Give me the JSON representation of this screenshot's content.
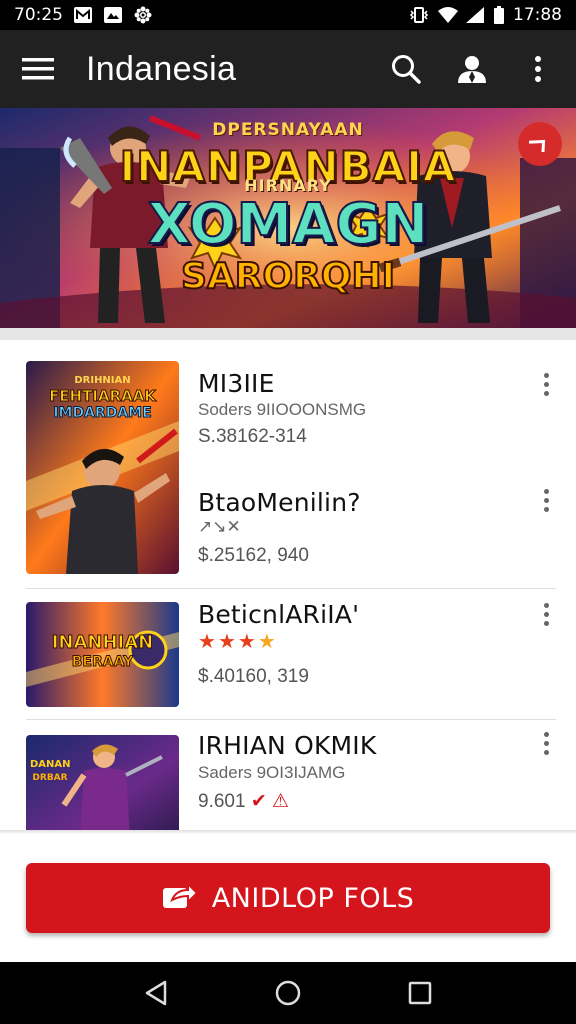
{
  "status_bar": {
    "time_left": "70:25",
    "time_right": "17:88",
    "icons_left": [
      "notification-icon",
      "photo-icon",
      "settings-flower-icon"
    ],
    "icons_right": [
      "vibrate-icon",
      "wifi-icon",
      "signal-icon",
      "battery-icon"
    ]
  },
  "app_bar": {
    "title": "Indanesia",
    "icons": [
      "menu-icon",
      "search-icon",
      "account-icon",
      "more-vert-icon"
    ]
  },
  "banner": {
    "line1": "DPERSNAYAAN",
    "line2": "INANPANBAIA",
    "line3": "HIRNARY",
    "line4": "XOMAGN",
    "line5": "SARORQHI",
    "close_icon": "chevron-close-icon"
  },
  "items": [
    {
      "thumb_text_1": "DRIHNIAN",
      "thumb_text_2": "FEHTIARAAK",
      "thumb_text_3": "IMDARDAME",
      "title": "MI3IIE",
      "subtitle": "Soders 9IIOOONSMG",
      "price": "S.38162-314"
    },
    {
      "title": "BtaoMenilin?",
      "subtitle": "↗↘✕",
      "price": "$.25162, 940"
    },
    {
      "thumb_text_1": "INANHIAN",
      "thumb_text_2": "BERAAY",
      "title": "BeticnlARiIA'",
      "rating": 4,
      "price": "$.40160, 319"
    },
    {
      "thumb_text_1": "DANAN",
      "thumb_text_2": "DRBAR",
      "title": "IRHIAN OKMIK",
      "subtitle": "Saders 9OI3IJAMG",
      "price": "9.601",
      "price_suffix": "✔ ⚠"
    }
  ],
  "cta": {
    "label": "ANIDLOP FOLS",
    "icon": "share-arrow-icon"
  },
  "nav_bar": {
    "icons": [
      "back-icon",
      "home-icon",
      "recents-icon"
    ]
  },
  "colors": {
    "accent": "#d4161c",
    "app_bar": "#212121",
    "status_bar": "#000000"
  }
}
